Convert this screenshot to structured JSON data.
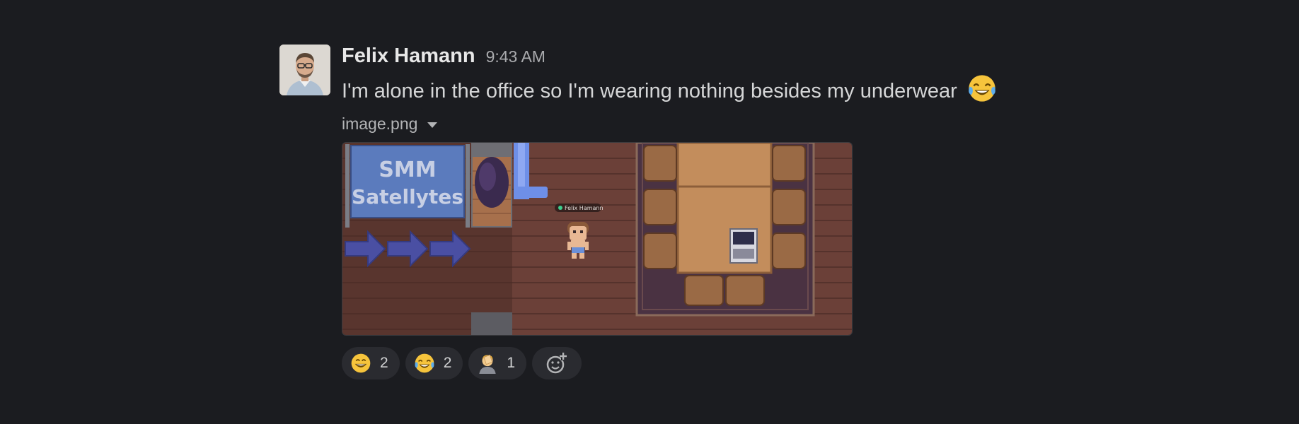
{
  "message": {
    "author": "Felix Hamann",
    "timestamp": "9:43 AM",
    "text": "I'm alone in the office so I'm wearing nothing besides my underwear",
    "text_emoji": "face-with-tears-of-joy"
  },
  "attachment": {
    "filename": "image.png",
    "image": {
      "sign_line1": "SMM",
      "sign_line2": "Satellytes",
      "player_tag": "Felix Hamann"
    }
  },
  "reactions": [
    {
      "emoji": "grinning-face",
      "count": "2"
    },
    {
      "emoji": "face-with-tears-of-joy",
      "count": "2"
    },
    {
      "emoji": "person-facepalming",
      "count": "1"
    }
  ],
  "add_reaction_icon": "add-reaction-icon"
}
